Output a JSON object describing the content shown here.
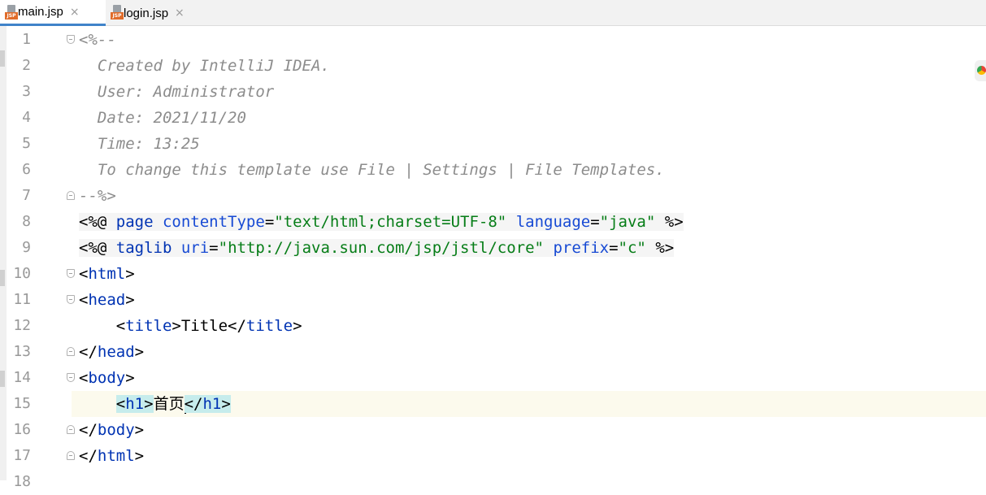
{
  "tabs": [
    {
      "label": "main.jsp",
      "active": true,
      "icon": "jsp-file-icon",
      "badge": "JSP"
    },
    {
      "label": "login.jsp",
      "active": false,
      "icon": "jsp-file-icon",
      "badge": "JSP"
    }
  ],
  "tab_close_glyph": "×",
  "editor": {
    "caret_line": 15,
    "lines": [
      {
        "n": "1",
        "segments": [
          {
            "t": "<%--",
            "c": "comment"
          }
        ],
        "fold": "open"
      },
      {
        "n": "2",
        "segments": [
          {
            "t": "  Created by IntelliJ IDEA.",
            "c": "comment"
          }
        ]
      },
      {
        "n": "3",
        "segments": [
          {
            "t": "  User: Administrator",
            "c": "comment"
          }
        ]
      },
      {
        "n": "4",
        "segments": [
          {
            "t": "  Date: 2021/11/20",
            "c": "comment"
          }
        ]
      },
      {
        "n": "5",
        "segments": [
          {
            "t": "  Time: 13:25",
            "c": "comment"
          }
        ]
      },
      {
        "n": "6",
        "segments": [
          {
            "t": "  To change this template use File | Settings | File Templates.",
            "c": "comment"
          }
        ]
      },
      {
        "n": "7",
        "segments": [
          {
            "t": "--%>",
            "c": "comment"
          }
        ],
        "fold": "close"
      },
      {
        "n": "8",
        "segments": [
          {
            "t": "<%@ ",
            "c": "black",
            "bg": true
          },
          {
            "t": "page ",
            "c": "tag",
            "bg": true
          },
          {
            "t": "contentType",
            "c": "attr",
            "bg": true
          },
          {
            "t": "=",
            "c": "black",
            "bg": true
          },
          {
            "t": "\"text/html;charset=UTF-8\"",
            "c": "str",
            "bg": true
          },
          {
            "t": " ",
            "c": "black",
            "bg": true
          },
          {
            "t": "language",
            "c": "attr",
            "bg": true
          },
          {
            "t": "=",
            "c": "black",
            "bg": true
          },
          {
            "t": "\"java\"",
            "c": "str",
            "bg": true
          },
          {
            "t": " %>",
            "c": "black",
            "bg": true
          }
        ]
      },
      {
        "n": "9",
        "segments": [
          {
            "t": "<%@ ",
            "c": "black",
            "bg": true
          },
          {
            "t": "taglib ",
            "c": "tag",
            "bg": true
          },
          {
            "t": "uri",
            "c": "attr",
            "bg": true
          },
          {
            "t": "=",
            "c": "black",
            "bg": true
          },
          {
            "t": "\"http://java.sun.com/jsp/jstl/core\"",
            "c": "str",
            "bg": true
          },
          {
            "t": " ",
            "c": "black",
            "bg": true
          },
          {
            "t": "prefix",
            "c": "attr",
            "bg": true
          },
          {
            "t": "=",
            "c": "black",
            "bg": true
          },
          {
            "t": "\"c\"",
            "c": "str",
            "bg": true
          },
          {
            "t": " %>",
            "c": "black",
            "bg": true
          }
        ]
      },
      {
        "n": "10",
        "segments": [
          {
            "t": "<",
            "c": "black"
          },
          {
            "t": "html",
            "c": "tag"
          },
          {
            "t": ">",
            "c": "black"
          }
        ],
        "fold": "open"
      },
      {
        "n": "11",
        "segments": [
          {
            "t": "<",
            "c": "black"
          },
          {
            "t": "head",
            "c": "tag"
          },
          {
            "t": ">",
            "c": "black"
          }
        ],
        "fold": "open"
      },
      {
        "n": "12",
        "segments": [
          {
            "t": "    <",
            "c": "black"
          },
          {
            "t": "title",
            "c": "tag"
          },
          {
            "t": ">Title</",
            "c": "black"
          },
          {
            "t": "title",
            "c": "tag"
          },
          {
            "t": ">",
            "c": "black"
          }
        ]
      },
      {
        "n": "13",
        "segments": [
          {
            "t": "</",
            "c": "black"
          },
          {
            "t": "head",
            "c": "tag"
          },
          {
            "t": ">",
            "c": "black"
          }
        ],
        "fold": "close"
      },
      {
        "n": "14",
        "segments": [
          {
            "t": "<",
            "c": "black"
          },
          {
            "t": "body",
            "c": "tag"
          },
          {
            "t": ">",
            "c": "black"
          }
        ],
        "fold": "open"
      },
      {
        "n": "15",
        "segments": [
          {
            "t": "    ",
            "c": "black"
          },
          {
            "t": "<",
            "c": "black",
            "hl": true
          },
          {
            "t": "h1",
            "c": "tag",
            "hl": true
          },
          {
            "t": ">",
            "c": "black",
            "hl": true
          },
          {
            "t": "首页",
            "c": "black"
          },
          {
            "caret": true
          },
          {
            "t": "</",
            "c": "black",
            "hl": true
          },
          {
            "t": "h1",
            "c": "tag",
            "hl": true
          },
          {
            "t": ">",
            "c": "black",
            "hl": true
          }
        ]
      },
      {
        "n": "16",
        "segments": [
          {
            "t": "</",
            "c": "black"
          },
          {
            "t": "body",
            "c": "tag"
          },
          {
            "t": ">",
            "c": "black"
          }
        ],
        "fold": "close"
      },
      {
        "n": "17",
        "segments": [
          {
            "t": "</",
            "c": "black"
          },
          {
            "t": "html",
            "c": "tag"
          },
          {
            "t": ">",
            "c": "black"
          }
        ],
        "fold": "close"
      },
      {
        "n": "18",
        "segments": []
      }
    ]
  }
}
